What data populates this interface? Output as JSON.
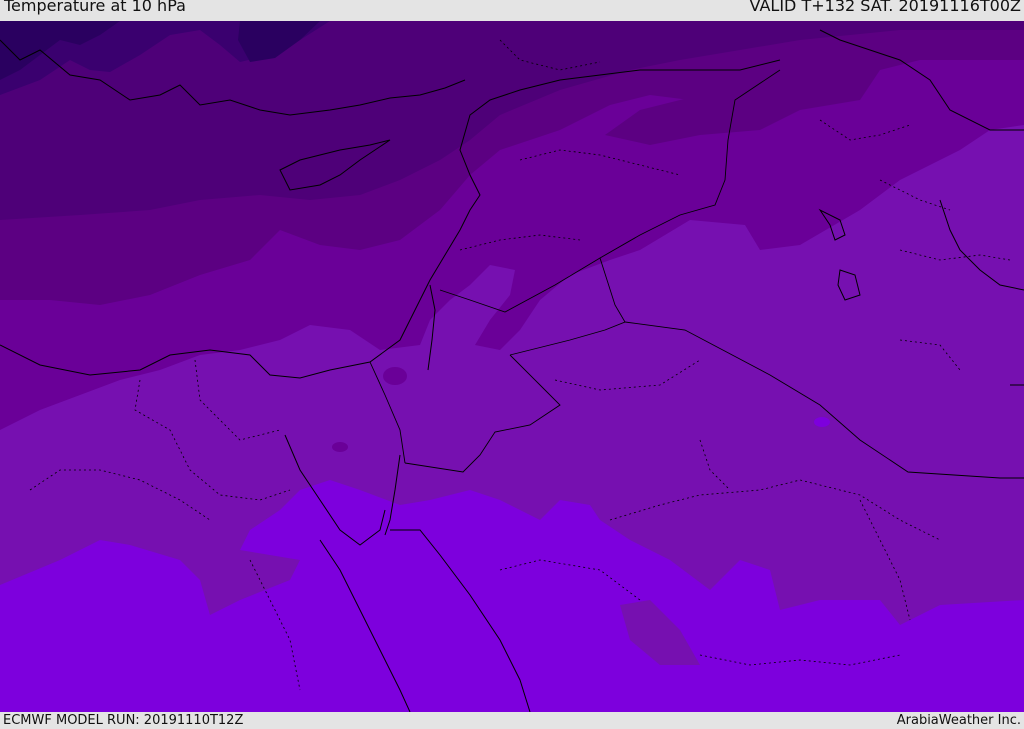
{
  "header": {
    "title": "Temperature at 10 hPa",
    "valid": "VALID T+132 SAT. 20191116T00Z"
  },
  "footer": {
    "model_run": "ECMWF MODEL RUN: 20191110T12Z",
    "brand": "ArabiaWeather Inc."
  },
  "palette": {
    "band_coldest": "#2a0060",
    "band_1": "#3a006f",
    "band_2": "#4e0078",
    "band_3": "#5c0082",
    "band_4": "#6a0098",
    "band_5": "#7610b0",
    "band_warmest": "#7d00dd",
    "coastline": "#000000"
  }
}
